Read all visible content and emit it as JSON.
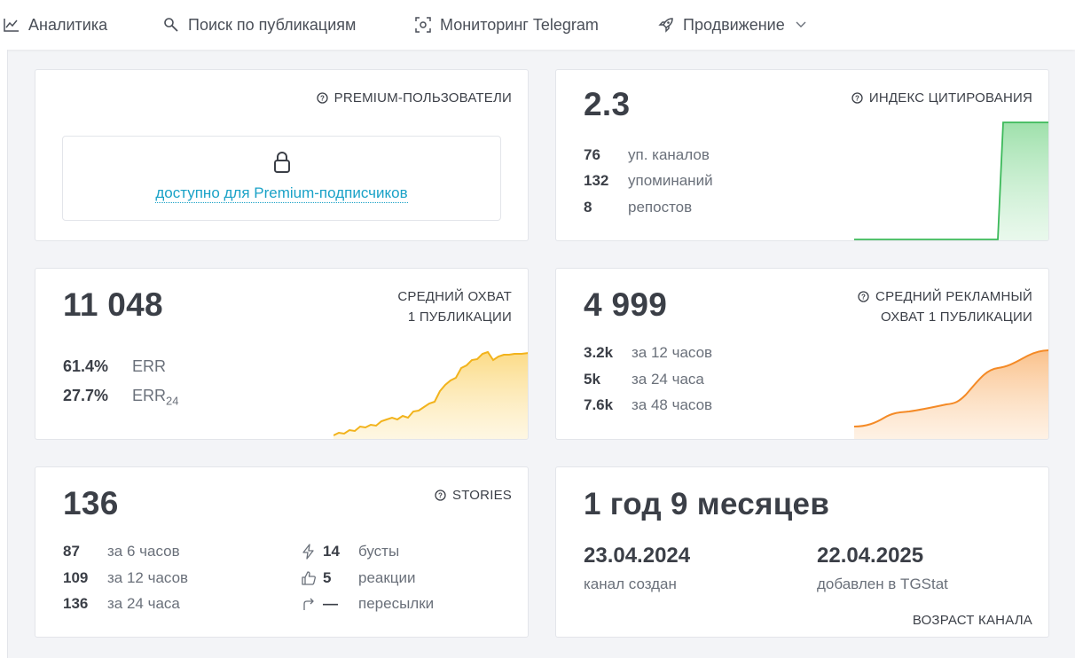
{
  "nav": {
    "items": [
      {
        "label": "Аналитика",
        "icon": "chart-line-icon"
      },
      {
        "label": "Поиск по публикациям",
        "icon": "search-icon"
      },
      {
        "label": "Мониторинг Telegram",
        "icon": "monitor-scan-icon"
      },
      {
        "label": "Продвижение",
        "icon": "rocket-icon"
      }
    ]
  },
  "premium_users": {
    "caption": "PREMIUM-ПОЛЬЗОВАТЕЛИ",
    "locked_text": "доступно для Premium-подписчиков"
  },
  "citation": {
    "value": "2.3",
    "caption": "ИНДЕКС ЦИТИРОВАНИЯ",
    "rows": [
      {
        "value": "76",
        "label": "уп. каналов"
      },
      {
        "value": "132",
        "label": "упоминаний"
      },
      {
        "value": "8",
        "label": "репостов"
      }
    ]
  },
  "reach": {
    "value": "11 048",
    "caption_line1": "СРЕДНИЙ ОХВАТ",
    "caption_line2": "1 ПУБЛИКАЦИИ",
    "rows": [
      {
        "value": "61.4%",
        "label": "ERR",
        "sub": ""
      },
      {
        "value": "27.7%",
        "label": "ERR",
        "sub": "24"
      }
    ]
  },
  "ad_reach": {
    "value": "4 999",
    "caption_line1": "СРЕДНИЙ РЕКЛАМНЫЙ",
    "caption_line2": "ОХВАТ 1 ПУБЛИКАЦИИ",
    "rows": [
      {
        "value": "3.2k",
        "label": "за 12 часов"
      },
      {
        "value": "5k",
        "label": "за 24 часа"
      },
      {
        "value": "7.6k",
        "label": "за 48 часов"
      }
    ]
  },
  "stories": {
    "value": "136",
    "caption": "STORIES",
    "rows": [
      {
        "value": "87",
        "label": "за 6 часов"
      },
      {
        "value": "109",
        "label": "за 12 часов"
      },
      {
        "value": "136",
        "label": "за 24 часа"
      }
    ],
    "stats": [
      {
        "icon": "lightning-icon",
        "value": "14",
        "label": "бусты"
      },
      {
        "icon": "thumbs-up-icon",
        "value": "5",
        "label": "реакции"
      },
      {
        "icon": "forward-arrow-icon",
        "value": "—",
        "label": "пересылки"
      }
    ]
  },
  "age": {
    "value": "1 год 9 месяцев",
    "created_date": "23.04.2024",
    "created_label": "канал создан",
    "added_date": "22.04.2025",
    "added_label": "добавлен в TGStat",
    "caption": "ВОЗРАСТ КАНАЛА"
  },
  "colors": {
    "citation": "#3cb95a",
    "reach": "#f2b31c",
    "ad_reach": "#f48a26",
    "link": "#1aa2c7"
  }
}
